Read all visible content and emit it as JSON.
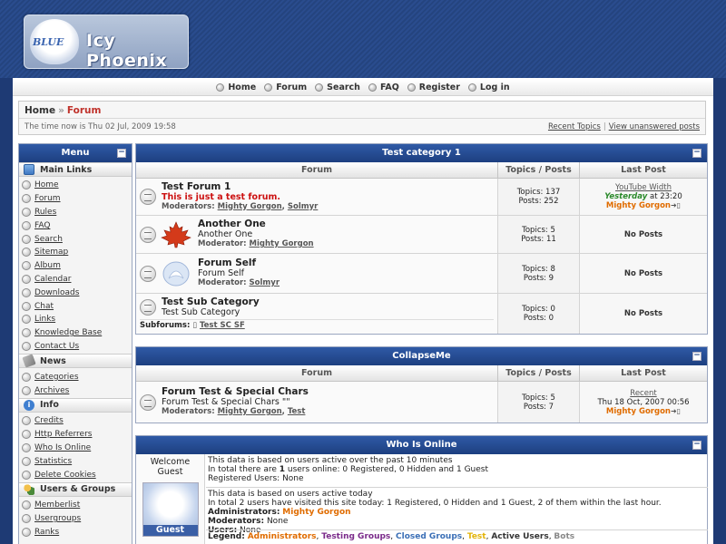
{
  "header": {
    "logo_small": "BLUE",
    "logo_title": "Icy Phoenix"
  },
  "nav": [
    "Home",
    "Forum",
    "Search",
    "FAQ",
    "Register",
    "Log in"
  ],
  "breadcrumb": {
    "home": "Home",
    "separator": "»",
    "current": "Forum",
    "time": "The time now is Thu 02 Jul, 2009 19:58",
    "link_recent": "Recent Topics",
    "link_sep": "|",
    "link_unanswered": "View unanswered posts"
  },
  "menu": {
    "title": "Menu",
    "toggle": "−",
    "sections": {
      "main": {
        "title": "Main Links",
        "items": [
          "Home",
          "Forum",
          "Rules",
          "FAQ",
          "Search",
          "Sitemap",
          "Album",
          "Calendar",
          "Downloads",
          "Chat",
          "Links",
          "Knowledge Base",
          "Contact Us"
        ]
      },
      "news": {
        "title": "News",
        "items": [
          "Categories",
          "Archives"
        ]
      },
      "info": {
        "title": "Info",
        "items": [
          "Credits",
          "Http Referrers",
          "Who Is Online",
          "Statistics",
          "Delete Cookies"
        ]
      },
      "users": {
        "title": "Users & Groups",
        "items": [
          "Memberlist",
          "Usergroups",
          "Ranks"
        ]
      }
    }
  },
  "columns": {
    "forum": "Forum",
    "stats": "Topics / Posts",
    "last": "Last Post"
  },
  "cat1": {
    "title": "Test category 1",
    "forums": [
      {
        "title": "Test Forum 1",
        "desc": "This is just a test forum.",
        "mod_label": "Moderators:",
        "mods": [
          "Mighty Gorgon",
          "Solmyr"
        ],
        "topics": "Topics: 137",
        "posts": "Posts: 252",
        "last_link": "YouTube Width",
        "last_day": "Yesterday",
        "last_time": "at 23:20",
        "last_user": "Mighty Gorgon"
      },
      {
        "title": "Another One",
        "desc": "Another One",
        "mod_label": "Moderator:",
        "mods": [
          "Mighty Gorgon"
        ],
        "topics": "Topics: 5",
        "posts": "Posts: 11",
        "no_posts": "No Posts"
      },
      {
        "title": "Forum Self",
        "desc": "Forum Self",
        "mod_label": "Moderator:",
        "mods": [
          "Solmyr"
        ],
        "topics": "Topics: 8",
        "posts": "Posts: 9",
        "no_posts": "No Posts"
      },
      {
        "title": "Test Sub Category",
        "desc": "Test Sub Category",
        "sub_label": "Subforums:",
        "sub": "Test SC SF",
        "topics": "Topics: 0",
        "posts": "Posts: 0",
        "no_posts": "No Posts"
      }
    ]
  },
  "cat2": {
    "title": "CollapseMe",
    "forum": {
      "title": "Forum Test & Special Chars",
      "desc": "Forum Test & Special Chars \"\"",
      "mod_label": "Moderators:",
      "mods": [
        "Mighty Gorgon",
        "Test"
      ],
      "topics": "Topics: 5",
      "posts": "Posts: 7",
      "last_link": "Recent",
      "last_date": "Thu 18 Oct, 2007 00:56",
      "last_user": "Mighty Gorgon"
    }
  },
  "online": {
    "title": "Who Is Online",
    "welcome": "Welcome",
    "guest": "Guest",
    "avatar_label": "Guest",
    "line1": "This data is based on users active over the past 10 minutes",
    "line2_a": "In total there are ",
    "line2_b": "1",
    "line2_c": " users online: 0 Registered, 0 Hidden and 1 Guest",
    "line3": "Registered Users: None",
    "line4": "This data is based on users active today",
    "line5": "In total 2 users have visited this site today: 1 Registered, 0 Hidden and 1 Guest, 2 of them within the last hour.",
    "admins_label": "Administrators:",
    "admins": "Mighty Gorgon",
    "mods_label": "Moderators:",
    "mods": "None",
    "users_label": "Users:",
    "users": "None",
    "legend_label": "Legend:",
    "legend": [
      "Administrators",
      "Testing Groups",
      "Closed Groups",
      "Test",
      "Active Users",
      "Bots"
    ]
  }
}
